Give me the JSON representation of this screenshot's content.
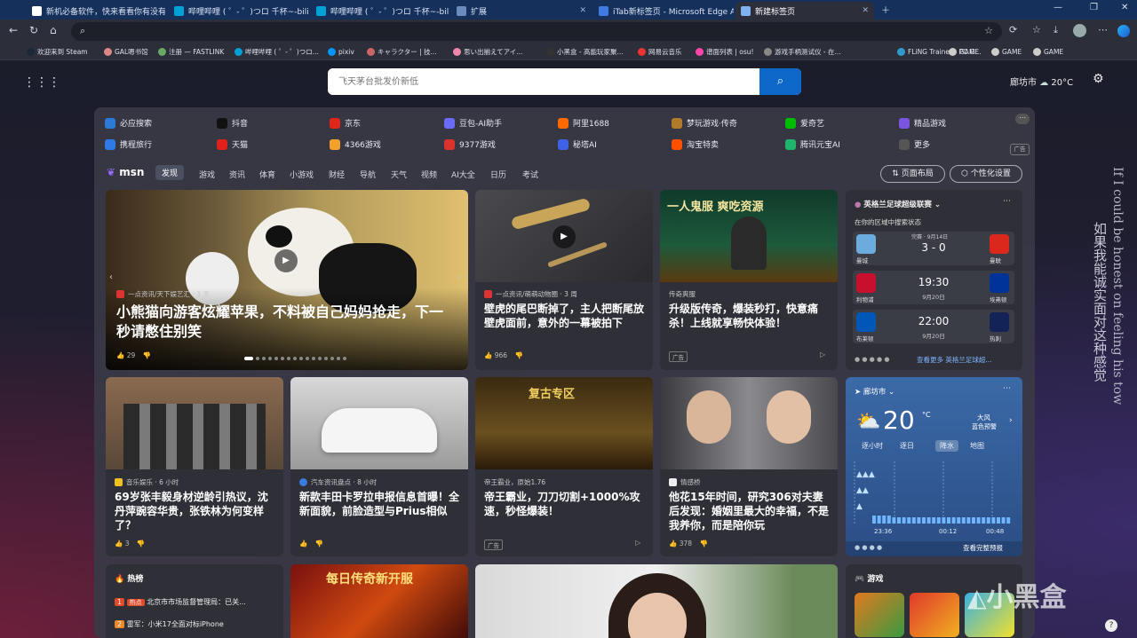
{
  "tabs": [
    {
      "label": "新机必备软件，快来看看你有没有"
    },
    {
      "label": "哔哩哔哩 ( ゜- ゜)つロ 千杯~-bilibi"
    },
    {
      "label": "哔哩哔哩 ( ゜- ゜)つロ 千杯~-bilib"
    },
    {
      "label": "扩展"
    },
    {
      "label": "iTab新标签页 - Microsoft Edge A"
    },
    {
      "label": "新建标签页"
    }
  ],
  "bookmarks": [
    "欢迎来到 Steam",
    "GAL嗯书馆",
    "注册 — FASTLINK",
    "哔哩哔哩 ( ゜- ゜)つロ...",
    "pixiv",
    "キャラクター | 技...",
    "思い出揃えてアイ...",
    "小黑盒 - 高能玩家聚...",
    "网易云音乐",
    "谱面列表 | osu!",
    "游戏手柄测试仪 - 在...",
    "FLiNG Trainer - PC G...",
    "GAME",
    "GAME",
    "GAME"
  ],
  "search": {
    "placeholder": "飞天茅台批发价新低"
  },
  "weather_top": {
    "city": "廊坊市",
    "temp": "20°C"
  },
  "quicklinks": [
    {
      "label": "必应搜索",
      "color": "#2b7bd6"
    },
    {
      "label": "抖音",
      "color": "#111"
    },
    {
      "label": "京东",
      "color": "#e1251b"
    },
    {
      "label": "豆包-AI助手",
      "color": "#6a6cf6"
    },
    {
      "label": "阿里1688",
      "color": "#ff6a00"
    },
    {
      "label": "梦玩游戏·传奇",
      "color": "#b07b2a"
    },
    {
      "label": "爱奇艺",
      "color": "#00be06"
    },
    {
      "label": "精品游戏",
      "color": "#7a55e0"
    },
    {
      "label": "携程旅行",
      "color": "#2e7be6"
    },
    {
      "label": "天猫",
      "color": "#e0201b"
    },
    {
      "label": "4366游戏",
      "color": "#f3a12b"
    },
    {
      "label": "9377游戏",
      "color": "#d9332c"
    },
    {
      "label": "秘塔AI",
      "color": "#3f61e6"
    },
    {
      "label": "淘宝特卖",
      "color": "#ff5000"
    },
    {
      "label": "腾讯元宝AI",
      "color": "#1fb36b"
    },
    {
      "label": "更多",
      "color": "#555"
    }
  ],
  "ad_label": "广告",
  "msn": {
    "logo": "msn",
    "tabs": [
      "发现",
      "游戏",
      "资讯",
      "体育",
      "小游戏",
      "财经",
      "导航",
      "天气",
      "视频",
      "AI大全",
      "日历",
      "考试"
    ],
    "layout_btn": "页面布局",
    "personalize_btn": "个性化设置"
  },
  "cards": {
    "panda": {
      "source": "一点资讯/天下娱艺汇 · 3 天",
      "title": "小熊猫向游客炫耀苹果，不料被自己妈妈抢走，下一秒请憋住别笑",
      "likes": "29"
    },
    "gecko": {
      "source": "一点资讯/萌萌动物圈 · 3 周",
      "title": "壁虎的尾巴断掉了，主人把断尾放壁虎面前，意外的一幕被拍下",
      "likes": "966"
    },
    "legend": {
      "source": "传奇爽服",
      "title": "升级版传奇，爆装秒打，快意痛杀！上线就享畅快体验！",
      "ad": "广告",
      "img_text": "一人鬼服  爽吃资源"
    },
    "zhang": {
      "source": "音乐娱乐 · 6 小时",
      "title": "69岁张丰毅身材逆龄引热议，沈丹萍豌容华贵，张铁林为何变样了？",
      "likes": "3"
    },
    "toyota": {
      "source": "汽车资讯盘点 · 8 小时",
      "title": "新款丰田卡罗拉申报信息首曝！全新面貌，前脸造型与Prius相似"
    },
    "emperor": {
      "source": "帝王霸业，原始1.76",
      "title": "帝王霸业，刀刀切割+1000%攻速，秒怪爆装！",
      "ad": "广告",
      "img_text": "复古专区"
    },
    "drama": {
      "source": "情感桥",
      "title": "他花15年时间，研究306对夫妻后发现：婚姻里最大的幸福，不是我养你，而是陪你玩",
      "likes": "378"
    }
  },
  "sports": {
    "league": "英格兰足球超级联赛",
    "subtitle": "在你的区域中搜索状态",
    "matches": [
      {
        "home": "曼城",
        "away": "曼联",
        "status": "完赛 · 9月14日",
        "score": "3 - 0",
        "home_color": "#6cabdd",
        "away_color": "#da291c"
      },
      {
        "home": "利物浦",
        "away": "埃弗顿",
        "status": "",
        "score": "19:30",
        "date": "9月20日",
        "home_color": "#c8102e",
        "away_color": "#003399"
      },
      {
        "home": "布莱顿",
        "away": "热刺",
        "status": "",
        "score": "22:00",
        "date": "9月20日",
        "home_color": "#0057b8",
        "away_color": "#132257"
      }
    ],
    "more": "查看更多 英格兰足球超..."
  },
  "weather": {
    "city": "廊坊市",
    "temp": "20",
    "unit": "°C",
    "cond1": "大风",
    "cond2": "蓝色预警",
    "tabs": [
      "逐小时",
      "逐日",
      "降水",
      "地图"
    ],
    "times": [
      "23:36",
      "00:12",
      "00:48"
    ],
    "more": "查看完整预报"
  },
  "hot": {
    "title": "热榜",
    "items": [
      {
        "rank": "1",
        "tag": "热点",
        "text": "北京市市场监督管理局：已关..."
      },
      {
        "rank": "2",
        "text": "雷军：小米17全面对标iPhone"
      }
    ]
  },
  "legend2": {
    "img_text": "每日传奇新开服"
  },
  "games": {
    "title": "游戏"
  },
  "overlay": {
    "english": "If I could be honest on feeling his tow",
    "chinese": "如果我能诚实面对这种感觉",
    "watermark": "小黑盒"
  }
}
